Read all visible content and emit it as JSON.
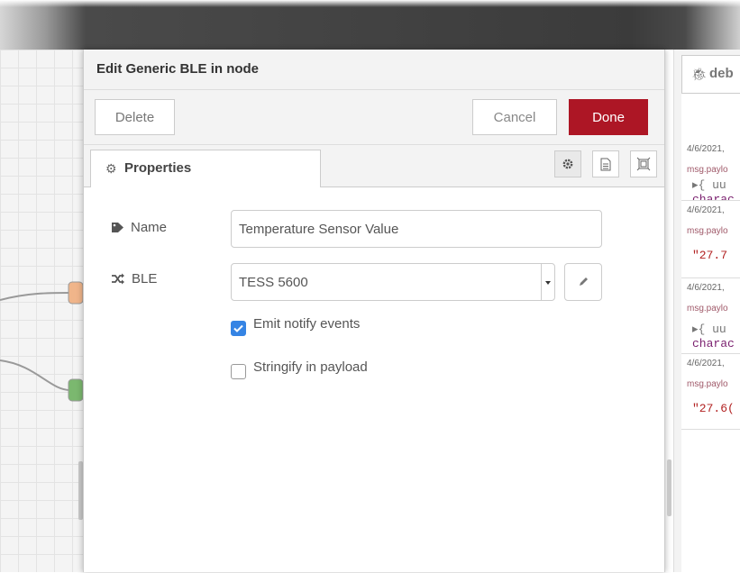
{
  "dialog": {
    "title": "Edit Generic BLE in node",
    "buttons": {
      "delete": "Delete",
      "cancel": "Cancel",
      "done": "Done"
    },
    "tab": {
      "label": "Properties",
      "icon": "gear-icon"
    },
    "tab_icons": [
      "gear-icon",
      "document-icon",
      "frame-icon"
    ],
    "fields": {
      "name": {
        "label": "Name",
        "icon": "tag-icon",
        "value": "Temperature Sensor Value"
      },
      "ble": {
        "label": "BLE",
        "icon": "shuffle-icon",
        "value": "TESS 5600"
      }
    },
    "checkboxes": [
      {
        "label": "Emit notify events",
        "checked": true
      },
      {
        "label": "Stringify in payload",
        "checked": false
      }
    ]
  },
  "sidebar": {
    "tab_label": "deb",
    "tab_icon": "bug-icon",
    "messages": [
      {
        "timestamp": "4/6/2021,",
        "topic": "msg.paylo",
        "line1": "▸{ uu",
        "line2": "charac"
      },
      {
        "timestamp": "4/6/2021,",
        "topic": "msg.paylo",
        "line1": "\"27.7"
      },
      {
        "timestamp": "4/6/2021,",
        "topic": "msg.paylo",
        "line1": "▸{ uu",
        "line2": "charac"
      },
      {
        "timestamp": "4/6/2021,",
        "topic": "msg.paylo",
        "line1": "\"27.6("
      }
    ]
  },
  "colors": {
    "done_button": "#ad1625",
    "checkbox_checked": "#3584e4",
    "header": "#3b3b3b"
  }
}
